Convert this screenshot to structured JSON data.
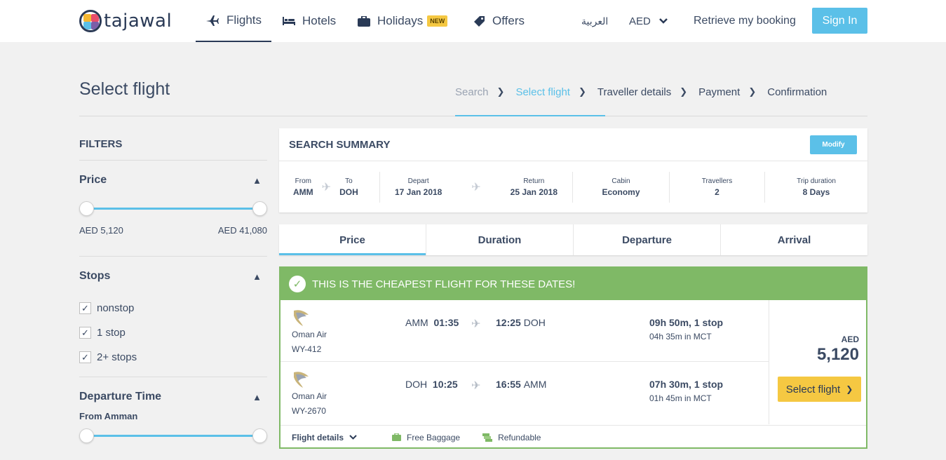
{
  "brand": {
    "name": "tajawal"
  },
  "nav": {
    "flights": "Flights",
    "hotels": "Hotels",
    "holidays": "Holidays",
    "holidays_badge": "NEW",
    "offers": "Offers",
    "language": "العربية",
    "currency": "AED",
    "retrieve": "Retrieve my booking",
    "signin": "Sign In"
  },
  "page": {
    "title": "Select flight"
  },
  "steps": [
    {
      "label": "Search",
      "state": "done"
    },
    {
      "label": "Select flight",
      "state": "current"
    },
    {
      "label": "Traveller details",
      "state": "upcoming"
    },
    {
      "label": "Payment",
      "state": "upcoming"
    },
    {
      "label": "Confirmation",
      "state": "upcoming"
    }
  ],
  "filters": {
    "title": "FILTERS",
    "price": {
      "heading": "Price",
      "min_label": "AED 5,120",
      "max_label": "AED 41,080",
      "range_selected": [
        0,
        1
      ]
    },
    "stops": {
      "heading": "Stops",
      "options": [
        {
          "label": "nonstop",
          "checked": true
        },
        {
          "label": "1 stop",
          "checked": true
        },
        {
          "label": "2+ stops",
          "checked": true
        }
      ]
    },
    "departure_time": {
      "heading": "Departure Time",
      "from_label": "From Amman",
      "range_selected": [
        0,
        1
      ]
    }
  },
  "summary": {
    "title": "SEARCH SUMMARY",
    "modify": "Modify",
    "from_label": "From",
    "from_value": "AMM",
    "to_label": "To",
    "to_value": "DOH",
    "depart_label": "Depart",
    "depart_value": "17 Jan 2018",
    "return_label": "Return",
    "return_value": "25 Jan 2018",
    "cabin_label": "Cabin",
    "cabin_value": "Economy",
    "travellers_label": "Travellers",
    "travellers_value": "2",
    "duration_label": "Trip duration",
    "duration_value": "8 Days"
  },
  "sort_tabs": {
    "price": "Price",
    "duration": "Duration",
    "departure": "Departure",
    "arrival": "Arrival",
    "active": "Price"
  },
  "result": {
    "banner": "THIS IS THE CHEAPEST FLIGHT FOR THESE DATES!",
    "legs": [
      {
        "airline": "Oman Air",
        "flight_no": "WY-412",
        "from": "AMM",
        "dep_time": "01:35",
        "arr_time": "12:25",
        "to": "DOH",
        "duration": "09h 50m, 1 stop",
        "layover": "04h 35m in  MCT"
      },
      {
        "airline": "Oman Air",
        "flight_no": "WY-2670",
        "from": "DOH",
        "dep_time": "10:25",
        "arr_time": "16:55",
        "to": "AMM",
        "duration": "07h 30m, 1 stop",
        "layover": "01h 45m in  MCT"
      }
    ],
    "currency": "AED",
    "amount": "5,120",
    "select": "Select flight",
    "flight_details": "Flight details",
    "baggage": "Free Baggage",
    "refundable": "Refundable"
  },
  "colors": {
    "accent": "#5bc0e8",
    "navy": "#2a3a56",
    "success": "#7fb966",
    "cta": "#f5c842"
  }
}
